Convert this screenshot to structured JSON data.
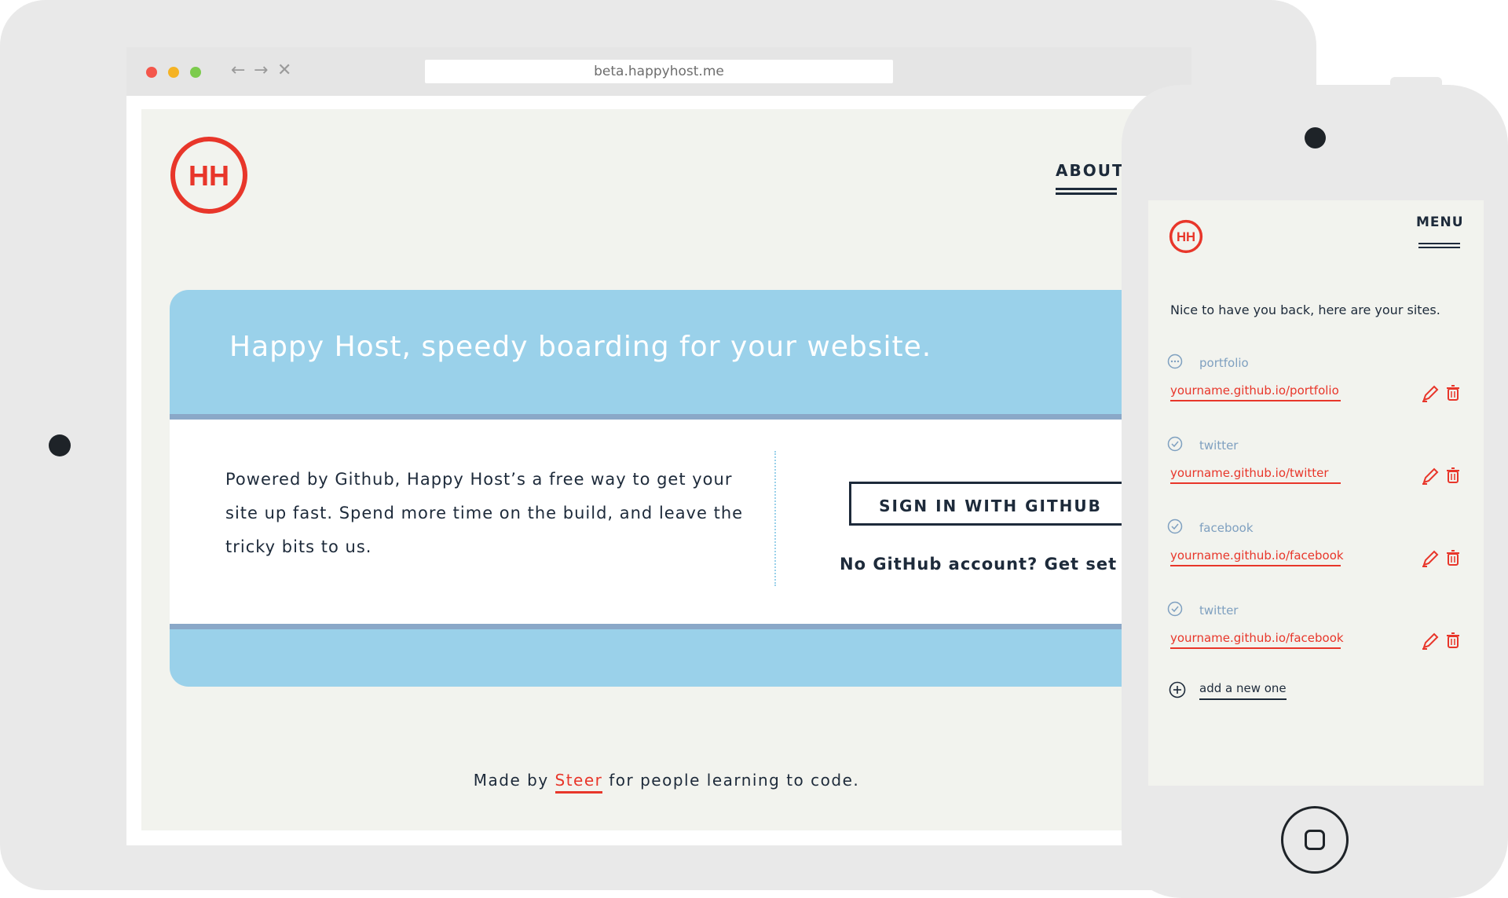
{
  "browser": {
    "url": "beta.happyhost.me",
    "back_icon": "←",
    "forward_icon": "→",
    "close_icon": "✕"
  },
  "site": {
    "logo_text": "HH",
    "nav_about": "ABOUT",
    "hero_title": "Happy Host, speedy boarding for your website.",
    "description": "Powered by Github, Happy Host’s a free way to get your site up fast. Spend more time on the build, and leave the tricky bits to us.",
    "signin_label": "SIGN IN WITH GITHUB",
    "no_account": "No GitHub account? Get set up",
    "footer_prefix": "Made by ",
    "footer_link": "Steer",
    "footer_suffix": " for people learning to code."
  },
  "mobile": {
    "logo_text": "HH",
    "menu_label": "MENU",
    "welcome": "Nice to have you back, here are your sites.",
    "sites": [
      {
        "name": "portfolio",
        "url": "yourname.github.io/portfolio",
        "status_icon": "pending-icon"
      },
      {
        "name": "twitter",
        "url": "yourname.github.io/twitter",
        "status_icon": "check-icon"
      },
      {
        "name": "facebook",
        "url": "yourname.github.io/facebook",
        "status_icon": "check-icon"
      },
      {
        "name": "twitter",
        "url": "yourname.github.io/facebook",
        "status_icon": "check-icon"
      }
    ],
    "add_label": "add a new one"
  },
  "colors": {
    "brand_red": "#e8362a",
    "hero_blue": "#9ad1ea",
    "ink": "#1d2a3a",
    "page_bg": "#f2f3ee"
  }
}
